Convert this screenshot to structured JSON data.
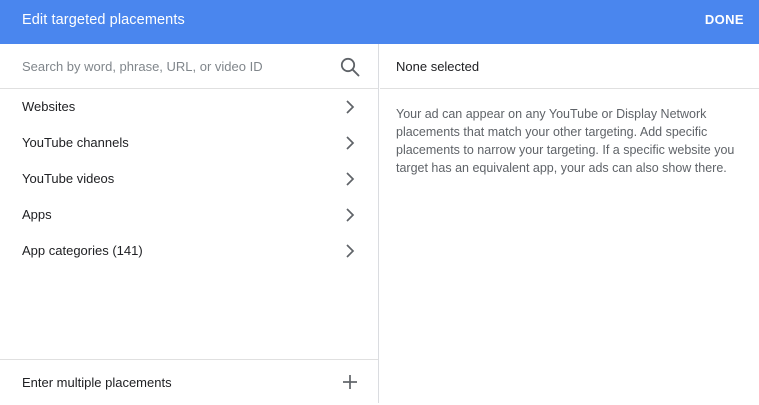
{
  "header": {
    "title": "Edit targeted placements",
    "done_label": "DONE",
    "background_color": "#4a86ee"
  },
  "search": {
    "placeholder": "Search by word, phrase, URL, or video ID",
    "value": "",
    "icon": "search-icon"
  },
  "categories": [
    {
      "label": "Websites",
      "icon": "chevron-right-icon"
    },
    {
      "label": "YouTube channels",
      "icon": "chevron-right-icon"
    },
    {
      "label": "YouTube videos",
      "icon": "chevron-right-icon"
    },
    {
      "label": "Apps",
      "icon": "chevron-right-icon"
    },
    {
      "label": "App categories (141)",
      "icon": "chevron-right-icon"
    }
  ],
  "footer": {
    "label": "Enter multiple placements",
    "icon": "plus-icon"
  },
  "selected_panel": {
    "status": "None selected",
    "info": "Your ad can appear on any YouTube or Display Network placements that match your other targeting. Add specific placements to narrow your targeting. If a specific website you target has an equivalent app, your ads can also show there."
  }
}
